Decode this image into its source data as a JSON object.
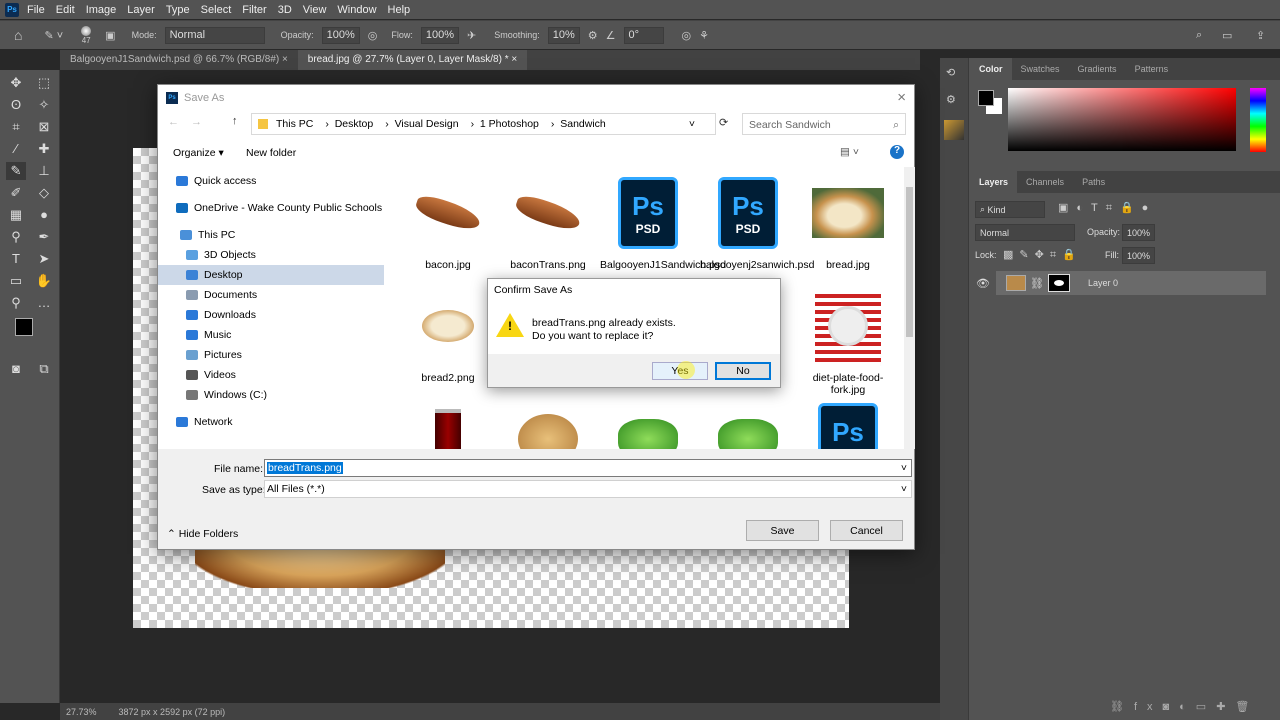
{
  "app": {
    "logo": "Ps",
    "menu": [
      "File",
      "Edit",
      "Image",
      "Layer",
      "Type",
      "Select",
      "Filter",
      "3D",
      "View",
      "Window",
      "Help"
    ]
  },
  "options": {
    "brush_size": "47",
    "mode_label": "Mode:",
    "mode": "Normal",
    "opacity_label": "Opacity:",
    "opacity": "100%",
    "flow_label": "Flow:",
    "flow": "100%",
    "smoothing_label": "Smoothing:",
    "smoothing": "10%",
    "angle": "0°"
  },
  "doc_tabs": [
    {
      "label": "BalgooyenJ1Sandwich.psd @ 66.7% (RGB/8#)",
      "active": false
    },
    {
      "label": "bread.jpg @ 27.7% (Layer 0, Layer Mask/8) *",
      "active": true
    }
  ],
  "status": {
    "zoom": "27.73%",
    "size": "3872 px x 2592 px (72 ppi)"
  },
  "color_panel": {
    "tabs": [
      "Color",
      "Swatches",
      "Gradients",
      "Patterns"
    ],
    "foreground": "#000000",
    "background": "#ffffff",
    "hue": "#ff0000"
  },
  "layers_panel": {
    "tabs": [
      "Layers",
      "Channels",
      "Paths"
    ],
    "filter": "Kind",
    "blend": "Normal",
    "opacity_label": "Opacity:",
    "opacity": "100%",
    "lock_label": "Lock:",
    "fill_label": "Fill:",
    "fill": "100%",
    "layers": [
      {
        "name": "Layer 0",
        "visible": true
      }
    ]
  },
  "save_as": {
    "title": "Save As",
    "path": [
      "This PC",
      "Desktop",
      "Visual Design",
      "1 Photoshop",
      "Sandwich"
    ],
    "search_placeholder": "Search Sandwich",
    "organize": "Organize ▾",
    "new_folder": "New folder",
    "nav": [
      {
        "label": "Quick access",
        "icon": "star",
        "color": "#2b79d8"
      },
      {
        "label": "OneDrive - Wake County Public Schools",
        "icon": "cloud",
        "color": "#0f6cbd"
      },
      {
        "label": "This PC",
        "icon": "pc",
        "color": "#4a90d9"
      },
      {
        "label": "3D Objects",
        "icon": "cube",
        "color": "#5aa0e0"
      },
      {
        "label": "Desktop",
        "icon": "desktop",
        "color": "#3b82d6",
        "selected": true
      },
      {
        "label": "Documents",
        "icon": "document",
        "color": "#8a9bb0"
      },
      {
        "label": "Downloads",
        "icon": "download",
        "color": "#2b79d8"
      },
      {
        "label": "Music",
        "icon": "music",
        "color": "#2b79d8"
      },
      {
        "label": "Pictures",
        "icon": "picture",
        "color": "#6aa0d0"
      },
      {
        "label": "Videos",
        "icon": "video",
        "color": "#555"
      },
      {
        "label": "Windows (C:)",
        "icon": "drive",
        "color": "#777"
      },
      {
        "label": "Network",
        "icon": "network",
        "color": "#2b79d8"
      }
    ],
    "files": [
      {
        "name": "bacon.jpg",
        "kind": "bacon"
      },
      {
        "name": "baconTrans.png",
        "kind": "bacon"
      },
      {
        "name": "BalgooyenJ1Sandwich.psd",
        "kind": "psd"
      },
      {
        "name": "balgooyenj2sanwich.psd",
        "kind": "psd"
      },
      {
        "name": "bread.jpg",
        "kind": "bread"
      },
      {
        "name": "bread2.png",
        "kind": "bread2"
      },
      {
        "name": "",
        "kind": "hidden"
      },
      {
        "name": "",
        "kind": "hidden"
      },
      {
        "name": "",
        "kind": "hidden"
      },
      {
        "name": "diet-plate-food-fork.jpg",
        "kind": "plate"
      },
      {
        "name": "",
        "kind": "can"
      },
      {
        "name": "",
        "kind": "cookie"
      },
      {
        "name": "",
        "kind": "lettuce"
      },
      {
        "name": "",
        "kind": "lettuce"
      },
      {
        "name": "",
        "kind": "psd"
      }
    ],
    "file_name_label": "File name:",
    "file_name": "breadTrans.png",
    "type_label": "Save as type:",
    "type": "All Files (*.*)",
    "hide_folders": "Hide Folders",
    "save": "Save",
    "cancel": "Cancel"
  },
  "confirm": {
    "title": "Confirm Save As",
    "line1": "breadTrans.png already exists.",
    "line2": "Do you want to replace it?",
    "yes": "Yes",
    "no": "No"
  }
}
